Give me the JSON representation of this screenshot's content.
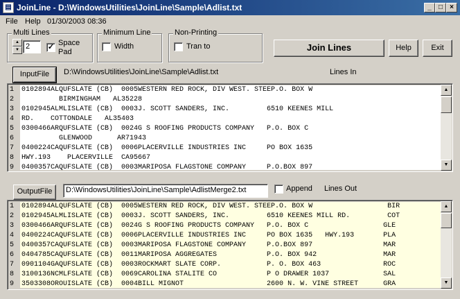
{
  "window": {
    "title": "JoinLine - D:\\WindowsUtilities\\JoinLine\\Sample\\Adlist.txt",
    "minimize_glyph": "_",
    "maximize_glyph": "□",
    "close_glyph": "×"
  },
  "menu": {
    "file": "File",
    "help": "Help",
    "datetime": "01/30/2003 08:36"
  },
  "options": {
    "multi_lines_label": "Multi Lines",
    "multi_lines_value": "2",
    "space_pad_label_1": "Space",
    "space_pad_label_2": "Pad",
    "space_pad_checked": "✓",
    "min_line_label": "Minimum Line",
    "width_label": "Width",
    "non_printing_label": "Non-Printing",
    "tran_to_label": "Tran to"
  },
  "buttons": {
    "join": "Join Lines",
    "help": "Help",
    "exit": "Exit",
    "input_file": "InputFile",
    "output_file": "OutputFile"
  },
  "input": {
    "path": "D:\\WindowsUtilities\\JoinLine\\Sample\\Adlist.txt",
    "lines_label": "Lines In",
    "line_numbers": [
      "1",
      "2",
      "3",
      "4",
      "5",
      "6",
      "7",
      "8",
      "9"
    ],
    "lines": [
      "0102894ALQUFSLATE (CB)  0005WESTERN RED ROCK, DIV WEST. STEEP.O. BOX W",
      "         BIRMINGHAM   AL35228",
      "0102945ALMLISLATE (CB)  0003J. SCOTT SANDERS, INC.         6510 KEENES MILL",
      "RD.    COTTONDALE   AL35403",
      "0300466ARQUFSLATE (CB)  0024G S ROOFING PRODUCTS COMPANY   P.O. BOX C",
      "         GLENWOOD      AR71943",
      "0400224CAQUFSLATE (CB)  0006PLACERVILLE INDUSTRIES INC     PO BOX 1635",
      "HWY.193    PLACERVILLE  CA95667",
      "0400357CAQUFSLATE (CB)  0003MARIPOSA FLAGSTONE COMPANY     P.O.BOX 897"
    ]
  },
  "output": {
    "path": "D:\\WindowsUtilities\\JoinLine\\Sample\\AdlistMerge2.txt",
    "append_label": "Append",
    "lines_label": "Lines Out",
    "line_numbers": [
      "1",
      "2",
      "3",
      "4",
      "5",
      "6",
      "7",
      "8",
      "9"
    ],
    "lines": [
      "0102894ALQUFSLATE (CB)  0005WESTERN RED ROCK, DIV WEST. STEEP.O. BOX W                  BIR",
      "0102945ALMLISLATE (CB)  0003J. SCOTT SANDERS, INC.         6510 KEENES MILL RD.         COT",
      "0300466ARQUFSLATE (CB)  0024G S ROOFING PRODUCTS COMPANY   P.O. BOX C                  GLE",
      "0400224CAQUFSLATE (CB)  0006PLACERVILLE INDUSTRIES INC     PO BOX 1635   HWY.193       PLA",
      "0400357CAQUFSLATE (CB)  0003MARIPOSA FLAGSTONE COMPANY     P.O.BOX 897                 MAR",
      "0404785CAQUFSLATE (CB)  0011MARIPOSA AGGREGATES            P.O. BOX 942                MAR",
      "0901104GAQUFSLATE (CB)  0003ROCKMART SLATE CORP.           P. O. BOX 463               ROC",
      "3100136NCMLFSLATE (CB)  0069CAROLINA STALITE CO            P O DRAWER 1037             SAL",
      "3503308OROUISLATE (CB)  0004BILL MIGNOT                    2600 N. W. VINE STREET      GRA"
    ]
  }
}
